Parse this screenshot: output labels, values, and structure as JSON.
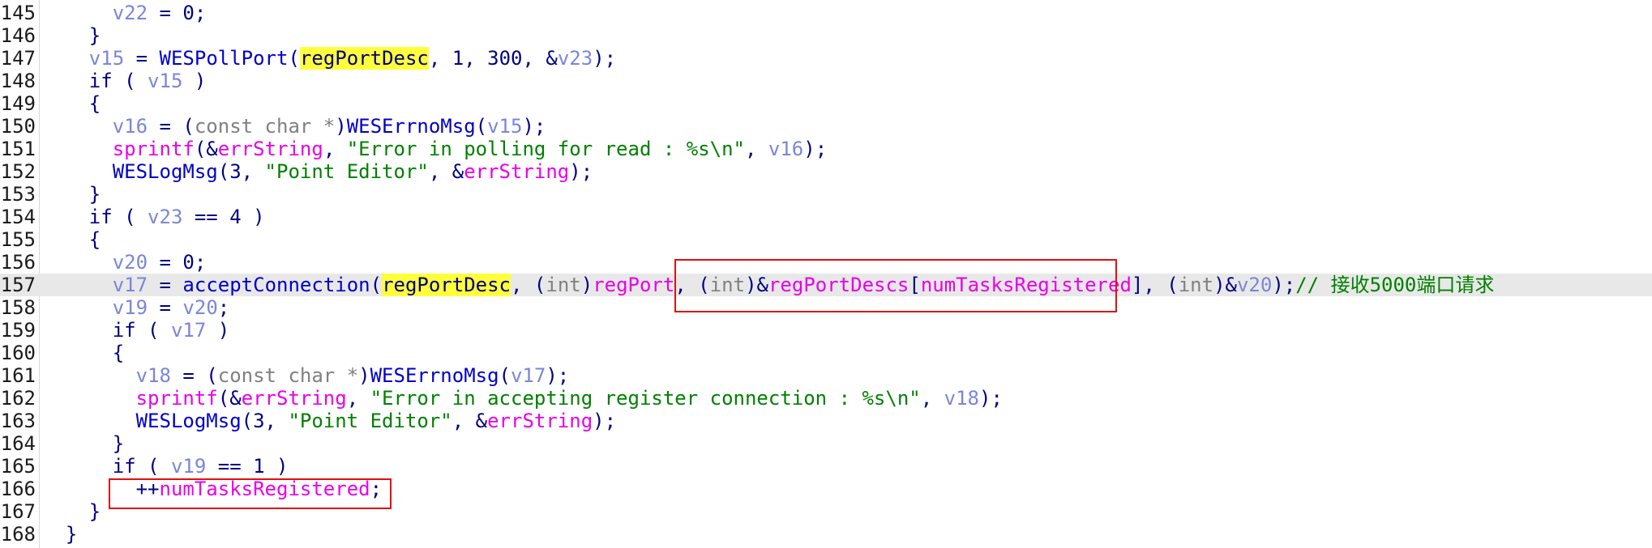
{
  "editor": {
    "lines": [
      {
        "number": "145",
        "tokens": [
          {
            "t": "      ",
            "k": "plain"
          },
          {
            "t": "v22",
            "k": "var"
          },
          {
            "t": " = 0;",
            "k": "plain"
          }
        ]
      },
      {
        "number": "146",
        "tokens": [
          {
            "t": "    }",
            "k": "plain"
          }
        ]
      },
      {
        "number": "147",
        "tokens": [
          {
            "t": "    ",
            "k": "plain"
          },
          {
            "t": "v15",
            "k": "var"
          },
          {
            "t": " = ",
            "k": "plain"
          },
          {
            "t": "WESPollPort",
            "k": "func"
          },
          {
            "t": "(",
            "k": "plain"
          },
          {
            "t": "regPortDesc",
            "k": "hl"
          },
          {
            "t": ", 1, 300, &",
            "k": "plain"
          },
          {
            "t": "v23",
            "k": "var"
          },
          {
            "t": ");",
            "k": "plain"
          }
        ]
      },
      {
        "number": "148",
        "tokens": [
          {
            "t": "    if ( ",
            "k": "kw"
          },
          {
            "t": "v15",
            "k": "var"
          },
          {
            "t": " )",
            "k": "plain"
          }
        ]
      },
      {
        "number": "149",
        "tokens": [
          {
            "t": "    {",
            "k": "plain"
          }
        ]
      },
      {
        "number": "150",
        "tokens": [
          {
            "t": "      ",
            "k": "plain"
          },
          {
            "t": "v16",
            "k": "var"
          },
          {
            "t": " = (",
            "k": "plain"
          },
          {
            "t": "const char *",
            "k": "type"
          },
          {
            "t": ")",
            "k": "plain"
          },
          {
            "t": "WESErrnoMsg",
            "k": "func"
          },
          {
            "t": "(",
            "k": "plain"
          },
          {
            "t": "v15",
            "k": "var"
          },
          {
            "t": ");",
            "k": "plain"
          }
        ]
      },
      {
        "number": "151",
        "tokens": [
          {
            "t": "      ",
            "k": "plain"
          },
          {
            "t": "sprintf",
            "k": "glob"
          },
          {
            "t": "(&",
            "k": "plain"
          },
          {
            "t": "errString",
            "k": "glob"
          },
          {
            "t": ", ",
            "k": "plain"
          },
          {
            "t": "\"Error in polling for read : %s\\n\"",
            "k": "str"
          },
          {
            "t": ", ",
            "k": "plain"
          },
          {
            "t": "v16",
            "k": "var"
          },
          {
            "t": ");",
            "k": "plain"
          }
        ]
      },
      {
        "number": "152",
        "tokens": [
          {
            "t": "      ",
            "k": "plain"
          },
          {
            "t": "WESLogMsg",
            "k": "func"
          },
          {
            "t": "(3, ",
            "k": "plain"
          },
          {
            "t": "\"Point Editor\"",
            "k": "str"
          },
          {
            "t": ", &",
            "k": "plain"
          },
          {
            "t": "errString",
            "k": "glob"
          },
          {
            "t": ");",
            "k": "plain"
          }
        ]
      },
      {
        "number": "153",
        "tokens": [
          {
            "t": "    }",
            "k": "plain"
          }
        ]
      },
      {
        "number": "154",
        "tokens": [
          {
            "t": "    if ( ",
            "k": "kw"
          },
          {
            "t": "v23",
            "k": "var"
          },
          {
            "t": " == 4 )",
            "k": "plain"
          }
        ]
      },
      {
        "number": "155",
        "tokens": [
          {
            "t": "    {",
            "k": "plain"
          }
        ]
      },
      {
        "number": "156",
        "tokens": [
          {
            "t": "      ",
            "k": "plain"
          },
          {
            "t": "v20",
            "k": "var"
          },
          {
            "t": " = 0;",
            "k": "plain"
          }
        ]
      },
      {
        "number": "157",
        "current": true,
        "tokens": [
          {
            "t": "      ",
            "k": "plain"
          },
          {
            "t": "v17",
            "k": "var"
          },
          {
            "t": " = ",
            "k": "plain"
          },
          {
            "t": "acceptConnection",
            "k": "func"
          },
          {
            "t": "(",
            "k": "plain"
          },
          {
            "t": "regPortDesc",
            "k": "hl"
          },
          {
            "t": ", (",
            "k": "plain"
          },
          {
            "t": "int",
            "k": "type"
          },
          {
            "t": ")",
            "k": "plain"
          },
          {
            "t": "regPort",
            "k": "glob"
          },
          {
            "t": ", (",
            "k": "plain"
          },
          {
            "t": "int",
            "k": "type"
          },
          {
            "t": ")&",
            "k": "plain"
          },
          {
            "t": "regPortDescs",
            "k": "glob"
          },
          {
            "t": "[",
            "k": "plain"
          },
          {
            "t": "numTasksRegistered",
            "k": "glob"
          },
          {
            "t": "], (",
            "k": "plain"
          },
          {
            "t": "int",
            "k": "type"
          },
          {
            "t": ")&",
            "k": "plain"
          },
          {
            "t": "v20",
            "k": "var"
          },
          {
            "t": ");",
            "k": "plain"
          },
          {
            "t": "// 接收5000端口请求",
            "k": "cmt"
          }
        ]
      },
      {
        "number": "158",
        "tokens": [
          {
            "t": "      ",
            "k": "plain"
          },
          {
            "t": "v19",
            "k": "var"
          },
          {
            "t": " = ",
            "k": "plain"
          },
          {
            "t": "v20",
            "k": "var"
          },
          {
            "t": ";",
            "k": "plain"
          }
        ]
      },
      {
        "number": "159",
        "tokens": [
          {
            "t": "      if ( ",
            "k": "kw"
          },
          {
            "t": "v17",
            "k": "var"
          },
          {
            "t": " )",
            "k": "plain"
          }
        ]
      },
      {
        "number": "160",
        "tokens": [
          {
            "t": "      {",
            "k": "plain"
          }
        ]
      },
      {
        "number": "161",
        "tokens": [
          {
            "t": "        ",
            "k": "plain"
          },
          {
            "t": "v18",
            "k": "var"
          },
          {
            "t": " = (",
            "k": "plain"
          },
          {
            "t": "const char *",
            "k": "type"
          },
          {
            "t": ")",
            "k": "plain"
          },
          {
            "t": "WESErrnoMsg",
            "k": "func"
          },
          {
            "t": "(",
            "k": "plain"
          },
          {
            "t": "v17",
            "k": "var"
          },
          {
            "t": ");",
            "k": "plain"
          }
        ]
      },
      {
        "number": "162",
        "tokens": [
          {
            "t": "        ",
            "k": "plain"
          },
          {
            "t": "sprintf",
            "k": "glob"
          },
          {
            "t": "(&",
            "k": "plain"
          },
          {
            "t": "errString",
            "k": "glob"
          },
          {
            "t": ", ",
            "k": "plain"
          },
          {
            "t": "\"Error in accepting register connection : %s\\n\"",
            "k": "str"
          },
          {
            "t": ", ",
            "k": "plain"
          },
          {
            "t": "v18",
            "k": "var"
          },
          {
            "t": ");",
            "k": "plain"
          }
        ]
      },
      {
        "number": "163",
        "tokens": [
          {
            "t": "        ",
            "k": "plain"
          },
          {
            "t": "WESLogMsg",
            "k": "func"
          },
          {
            "t": "(3, ",
            "k": "plain"
          },
          {
            "t": "\"Point Editor\"",
            "k": "str"
          },
          {
            "t": ", &",
            "k": "plain"
          },
          {
            "t": "errString",
            "k": "glob"
          },
          {
            "t": ");",
            "k": "plain"
          }
        ]
      },
      {
        "number": "164",
        "tokens": [
          {
            "t": "      }",
            "k": "plain"
          }
        ]
      },
      {
        "number": "165",
        "tokens": [
          {
            "t": "      if ( ",
            "k": "kw"
          },
          {
            "t": "v19",
            "k": "var"
          },
          {
            "t": " == 1 )",
            "k": "plain"
          }
        ]
      },
      {
        "number": "166",
        "tokens": [
          {
            "t": "        ++",
            "k": "plain"
          },
          {
            "t": "numTasksRegistered",
            "k": "glob"
          },
          {
            "t": ";",
            "k": "plain"
          }
        ]
      },
      {
        "number": "167",
        "tokens": [
          {
            "t": "    }",
            "k": "plain"
          }
        ]
      },
      {
        "number": "168",
        "tokens": [
          {
            "t": "  }",
            "k": "plain"
          }
        ]
      }
    ]
  },
  "colors": {
    "plain": "#000080",
    "var": "#7b86d8",
    "func": "#0000c8",
    "glob": "#e800e8",
    "str": "#008000",
    "type": "#808080",
    "highlight": "#ffff3a",
    "current_line": "#e8e8e8",
    "annotation": "#e01010"
  }
}
